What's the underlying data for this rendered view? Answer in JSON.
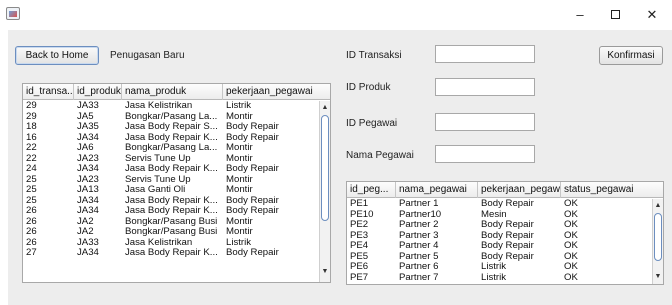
{
  "window": {
    "icon": "java-app-icon",
    "controls": {
      "minimize": "–",
      "close": "✕"
    }
  },
  "left": {
    "back_button": "Back to Home",
    "title": "Penugasan Baru",
    "table": {
      "columns": [
        "id_transa...",
        "id_produk",
        "nama_produk",
        "pekerjaan_pegawai"
      ],
      "rows": [
        [
          "29",
          "JA33",
          "Jasa Kelistrikan",
          "Listrik"
        ],
        [
          "29",
          "JA5",
          "Bongkar/Pasang La...",
          "Montir"
        ],
        [
          "18",
          "JA35",
          "Jasa Body Repair S...",
          "Body Repair"
        ],
        [
          "16",
          "JA34",
          "Jasa Body Repair K...",
          "Body Repair"
        ],
        [
          "22",
          "JA6",
          "Bongkar/Pasang La...",
          "Montir"
        ],
        [
          "22",
          "JA23",
          "Servis Tune Up",
          "Montir"
        ],
        [
          "24",
          "JA34",
          "Jasa Body Repair K...",
          "Body Repair"
        ],
        [
          "25",
          "JA23",
          "Servis Tune Up",
          "Montir"
        ],
        [
          "25",
          "JA13",
          "Jasa Ganti Oli",
          "Montir"
        ],
        [
          "25",
          "JA34",
          "Jasa Body Repair K...",
          "Body Repair"
        ],
        [
          "26",
          "JA34",
          "Jasa Body Repair K...",
          "Body Repair"
        ],
        [
          "26",
          "JA2",
          "Bongkar/Pasang Busi",
          "Montir"
        ],
        [
          "26",
          "JA2",
          "Bongkar/Pasang Busi",
          "Montir"
        ],
        [
          "26",
          "JA33",
          "Jasa Kelistrikan",
          "Listrik"
        ],
        [
          "27",
          "JA34",
          "Jasa Body Repair K...",
          "Body Repair"
        ]
      ]
    }
  },
  "form": {
    "id_transaksi_label": "ID Transaksi",
    "id_transaksi_value": "",
    "id_produk_label": "ID Produk",
    "id_produk_value": "",
    "id_pegawai_label": "ID Pegawai",
    "id_pegawai_value": "",
    "nama_pegawai_label": "Nama Pegawai",
    "nama_pegawai_value": "",
    "confirm_button": "Konfirmasi"
  },
  "right": {
    "table": {
      "columns": [
        "id_peg...",
        "nama_pegawai",
        "pekerjaan_pegaw...",
        "status_pegawai"
      ],
      "rows": [
        [
          "PE1",
          "Partner 1",
          "Body Repair",
          "OK"
        ],
        [
          "PE10",
          "Partner10",
          "Mesin",
          "OK"
        ],
        [
          "PE2",
          "Partner 2",
          "Body Repair",
          "OK"
        ],
        [
          "PE3",
          "Partner 3",
          "Body Repair",
          "OK"
        ],
        [
          "PE4",
          "Partner 4",
          "Body Repair",
          "OK"
        ],
        [
          "PE5",
          "Partner 5",
          "Body Repair",
          "OK"
        ],
        [
          "PE6",
          "Partner 6",
          "Listrik",
          "OK"
        ],
        [
          "PE7",
          "Partner 7",
          "Listrik",
          "OK"
        ]
      ]
    }
  }
}
